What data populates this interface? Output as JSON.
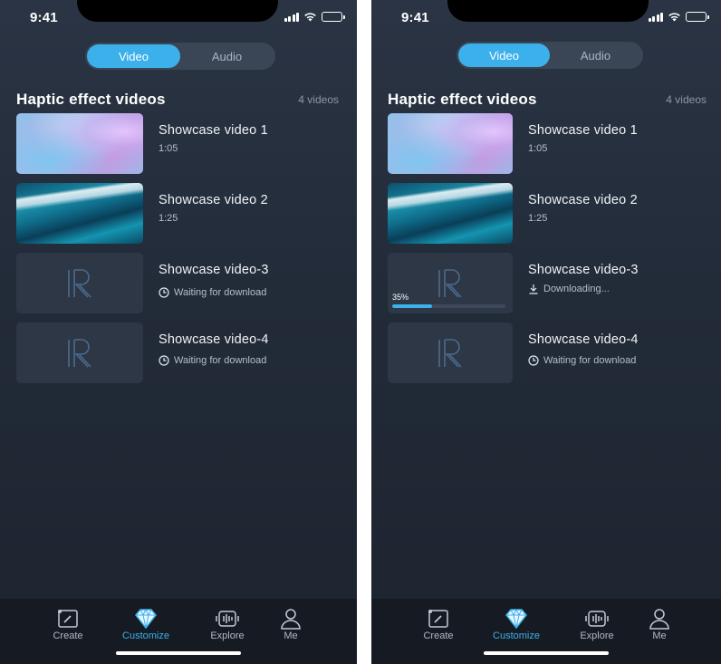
{
  "screens": [
    {
      "status": {
        "time": "9:41"
      },
      "segment": {
        "video": "Video",
        "audio": "Audio",
        "active": "Video"
      },
      "section": {
        "title": "Haptic effect videos",
        "count": "4 videos"
      },
      "videos": [
        {
          "title": "Showcase video 1",
          "subtitle": "1:05",
          "thumb": "purple"
        },
        {
          "title": "Showcase video 2",
          "subtitle": "1:25",
          "thumb": "teal"
        },
        {
          "title": "Showcase video-3",
          "subtitle": "Waiting for download",
          "icon": "clock-icon",
          "thumb": "placeholder"
        },
        {
          "title": "Showcase video-4",
          "subtitle": "Waiting for download",
          "icon": "clock-icon",
          "thumb": "placeholder"
        }
      ],
      "tabs": [
        {
          "label": "Create",
          "icon": "create-icon"
        },
        {
          "label": "Customize",
          "icon": "diamond-icon",
          "active": true
        },
        {
          "label": "Explore",
          "icon": "haptic-wave-icon"
        },
        {
          "label": "Me",
          "icon": "person-icon"
        }
      ]
    },
    {
      "status": {
        "time": "9:41"
      },
      "segment": {
        "video": "Video",
        "audio": "Audio",
        "active": "Video"
      },
      "section": {
        "title": "Haptic effect videos",
        "count": "4 videos"
      },
      "videos": [
        {
          "title": "Showcase video 1",
          "subtitle": "1:05",
          "thumb": "purple"
        },
        {
          "title": "Showcase video 2",
          "subtitle": "1:25",
          "thumb": "teal"
        },
        {
          "title": "Showcase video-3",
          "subtitle": "Downloading...",
          "icon": "download-icon",
          "thumb": "placeholder",
          "progress_label": "35%",
          "progress": 0.35
        },
        {
          "title": "Showcase video-4",
          "subtitle": "Waiting for download",
          "icon": "clock-icon",
          "thumb": "placeholder"
        }
      ],
      "tabs": [
        {
          "label": "Create",
          "icon": "create-icon"
        },
        {
          "label": "Customize",
          "icon": "diamond-icon",
          "active": true
        },
        {
          "label": "Explore",
          "icon": "haptic-wave-icon"
        },
        {
          "label": "Me",
          "icon": "person-icon"
        }
      ]
    }
  ],
  "colors": {
    "accent": "#3cb0ea",
    "background": "#222b38",
    "tab_bar": "#161b23"
  }
}
